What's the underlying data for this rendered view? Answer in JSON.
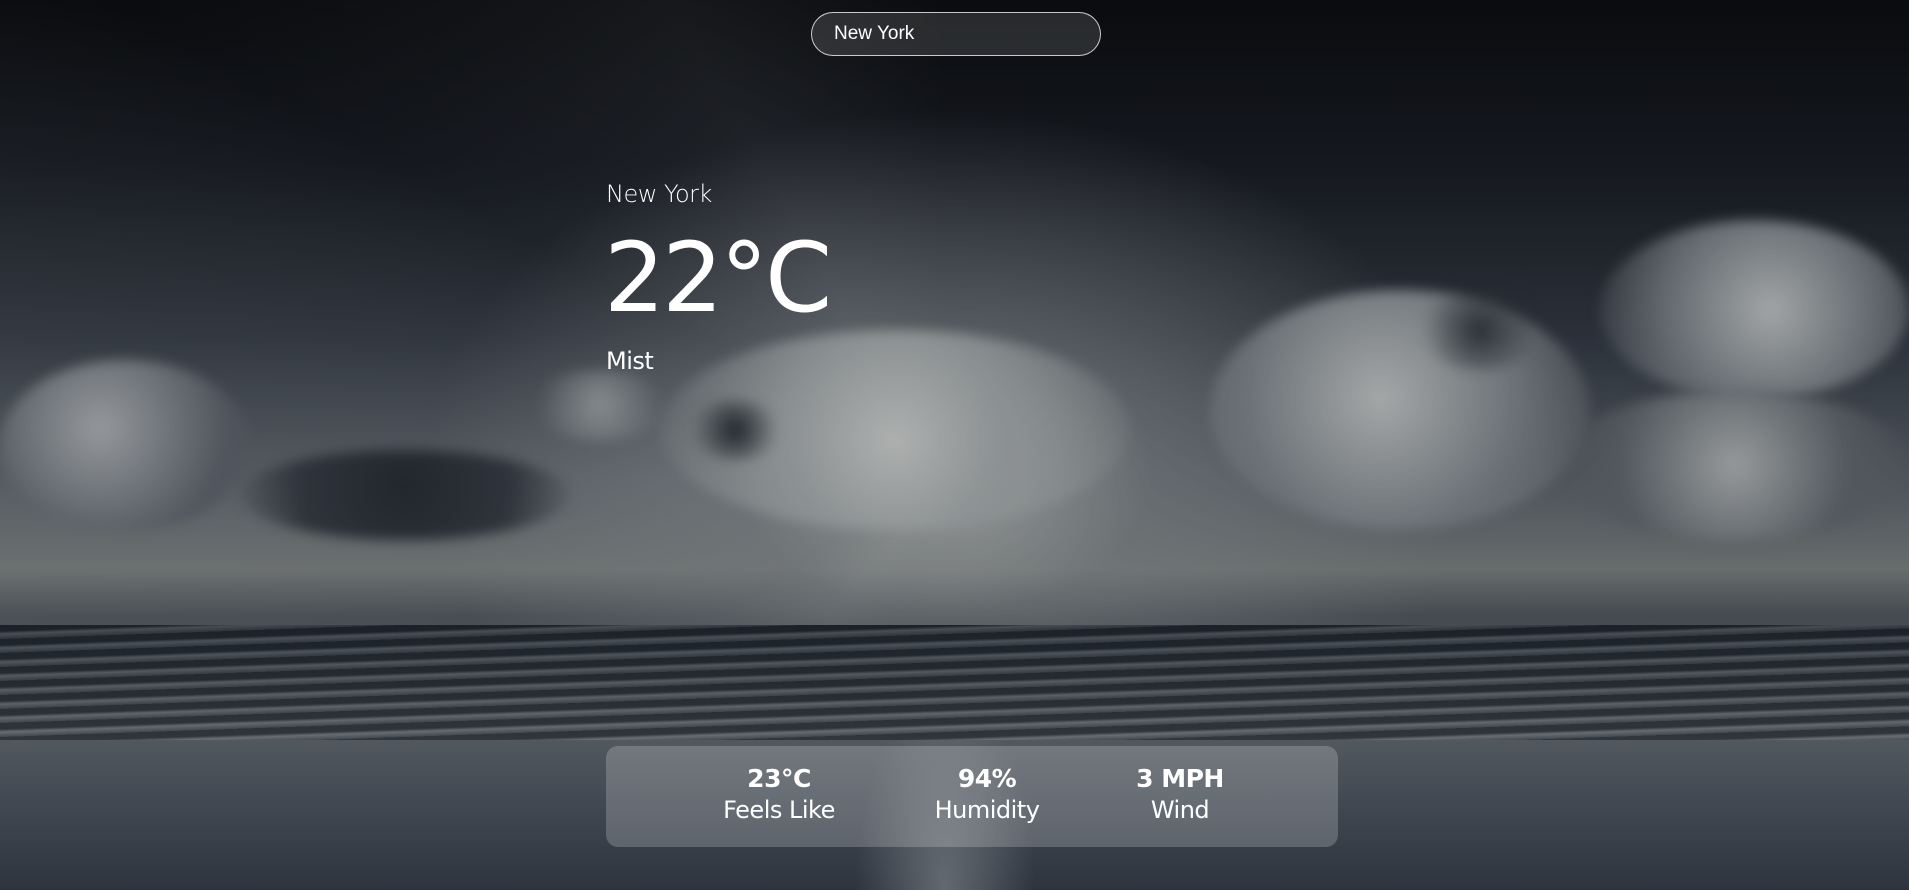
{
  "search": {
    "value": "New York",
    "placeholder": ""
  },
  "weather": {
    "location": "New York",
    "temperature": "22°C",
    "condition": "Mist"
  },
  "stats": {
    "feels_like": {
      "value": "23°C",
      "label": "Feels Like"
    },
    "humidity": {
      "value": "94%",
      "label": "Humidity"
    },
    "wind": {
      "value": "3 MPH",
      "label": "Wind"
    }
  }
}
